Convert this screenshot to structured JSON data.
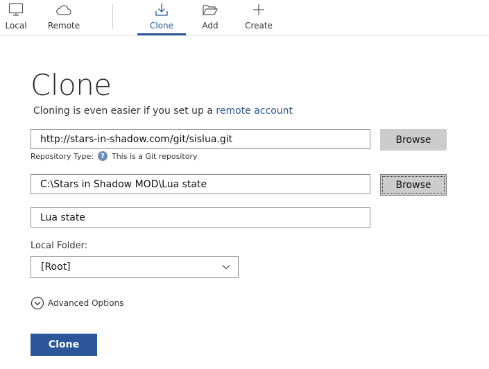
{
  "toolbar": {
    "local_label": "Local",
    "remote_label": "Remote",
    "clone_label": "Clone",
    "add_label": "Add",
    "create_label": "Create",
    "active_tab": "Clone",
    "accent_color": "#2b5797"
  },
  "main": {
    "title": "Clone",
    "subtitle_text": "Cloning is even easier if you set up a ",
    "subtitle_link": "remote account",
    "source_url": "http://stars-in-shadow.com/git/sislua.git",
    "repo_type_label": "Repository Type:",
    "repo_type_value": "This is a Git repository",
    "destination_path": "C:\\Stars in Shadow MOD\\Lua state",
    "name_value": "Lua state",
    "browse_label_1": "Browse",
    "browse_label_2": "Browse",
    "local_folder_label": "Local Folder:",
    "local_folder_value": "[Root]",
    "advanced_options_label": "Advanced Options",
    "clone_button_label": "Clone",
    "button_color": "#2b579a"
  }
}
